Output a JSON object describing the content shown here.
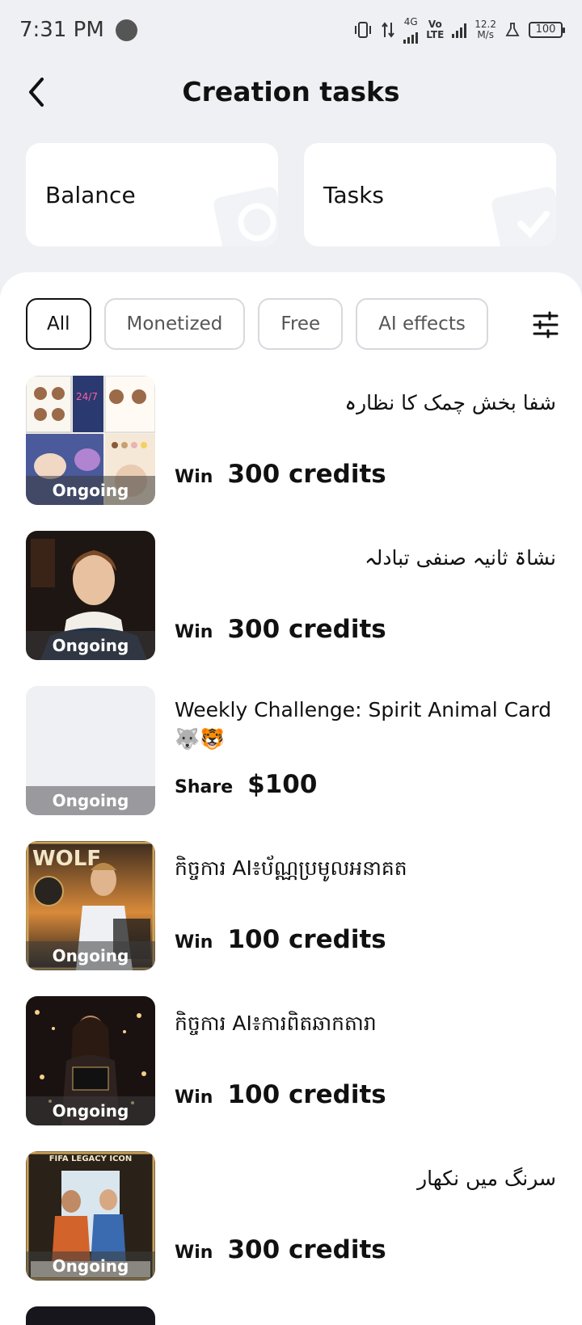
{
  "status_bar": {
    "time": "7:31 PM",
    "net_4g": "4G",
    "volte_top": "Vo",
    "volte_bottom": "LTE",
    "speed_value": "12.2",
    "speed_unit": "M/s",
    "battery": "100"
  },
  "header": {
    "title": "Creation tasks"
  },
  "summary": {
    "balance_label": "Balance",
    "tasks_label": "Tasks"
  },
  "filters": [
    "All",
    "Monetized",
    "Free",
    "AI effects"
  ],
  "tasks": [
    {
      "title": "شفا بخش چمک کا نظارہ",
      "rtl": true,
      "verb": "Win",
      "amount": "300 credits",
      "status": "Ongoing",
      "thumb": "pony-collage"
    },
    {
      "title": "نشاۃ ثانیہ صنفی تبادلہ",
      "rtl": true,
      "verb": "Win",
      "amount": "300 credits",
      "status": "Ongoing",
      "thumb": "renaissance-portrait"
    },
    {
      "title": "Weekly Challenge: Spirit Animal Card🐺🐯",
      "rtl": false,
      "verb": "Share",
      "amount": "$100",
      "status": "Ongoing",
      "thumb": "blank"
    },
    {
      "title": "កិច្ចការ AI៖ប័ណ្ណប្រមូលអនាគត",
      "rtl": false,
      "verb": "Win",
      "amount": "100 credits",
      "status": "Ongoing",
      "thumb": "wolf-card"
    },
    {
      "title": "កិច្ចការ AI៖ការពិតឆាកតារា",
      "rtl": false,
      "verb": "Win",
      "amount": "100 credits",
      "status": "Ongoing",
      "thumb": "stage-star"
    },
    {
      "title": "سرنگ میں نکھار",
      "rtl": true,
      "verb": "Win",
      "amount": "300 credits",
      "status": "Ongoing",
      "thumb": "fifa-legacy",
      "thumb_caption": "FIFA LEGACY ICON"
    }
  ],
  "colors": {
    "background": "#eef0f4",
    "card": "#ffffff",
    "chip_border": "#d8d8de",
    "text": "#111111"
  }
}
